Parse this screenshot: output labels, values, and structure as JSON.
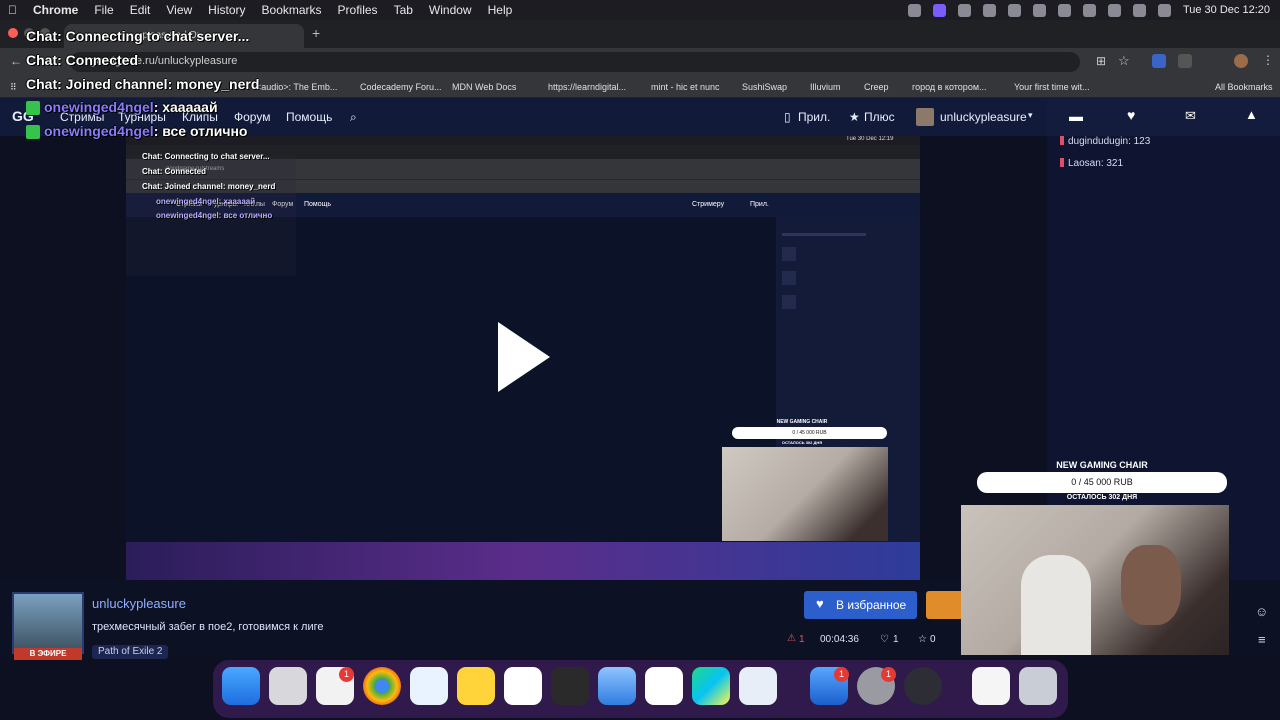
{
  "menubar": {
    "app": "Chrome",
    "items": [
      "File",
      "Edit",
      "View",
      "History",
      "Bookmarks",
      "Profiles",
      "Tab",
      "Window",
      "Help"
    ],
    "clock": "Tue 30 Dec  12:20"
  },
  "chrome": {
    "tab_title": "...pleasure / Or...",
    "url": "goodgame.ru/unluckypleasure",
    "bookmarks": [
      "<audio>: The Emb...",
      "Codecademy Foru...",
      "MDN Web Docs",
      "https://learndigital...",
      "mint - hic et nunc",
      "SushiSwap",
      "Illuvium",
      "Creep",
      "город в котором...",
      "Your first time wit...",
      "All Bookmarks"
    ]
  },
  "overlay_chat": {
    "line1": "Chat: Connecting to chat server...",
    "line2": "Chat: Connected",
    "line3": "Chat: Joined channel: money_nerd",
    "msg1_nick": "onewinged4ngel",
    "msg1_text": ": хааааай",
    "msg2_nick": "onewinged4ngel",
    "msg2_text": ": все отлично"
  },
  "site_nav": {
    "logo": "GG",
    "items": [
      "Стримы",
      "Турниры",
      "Клипы",
      "Форум",
      "Помощь"
    ],
    "app_link": "Прил.",
    "plus_link": "Плюс",
    "username": "unluckypleasure"
  },
  "right_panel": {
    "donations": [
      {
        "name": "dugindudugin",
        "amount": "123"
      },
      {
        "name": "Laosan",
        "amount": "321"
      }
    ]
  },
  "inner_screen": {
    "chat_line1": "Chat: Connecting to chat server...",
    "chat_line2": "Chat: Connected",
    "chat_line3": "Chat: Joined channel: money_nerd",
    "msg1": "onewinged4ngel: хааааай",
    "msg2": "onewinged4ngel: все отлично",
    "url": "goodgame.ru/streams",
    "nav": [
      "Стримы",
      "Турниры",
      "Клипы",
      "Форум",
      "Помощь"
    ],
    "streamer_btn": "Стримеру",
    "app_btn": "Прил.",
    "clock": "Tue 30 Dec 12:19",
    "goal_title": "NEW GAMING CHAIR",
    "goal_amount": "0 / 45 000 RUB",
    "goal_left": "ОСТАЛОСЬ 302 ДНЯ"
  },
  "goal": {
    "title": "NEW GAMING CHAIR",
    "amount": "0 / 45 000 RUB",
    "left": "ОСТАЛОСЬ 302 ДНЯ"
  },
  "stream_info": {
    "streamer": "unluckypleasure",
    "title": "трехмесячный забег в пое2, готовимся к лиге",
    "game": "Path of Exile 2",
    "live": "В ЭФИРЕ",
    "fav_button": "В избранное",
    "viewers": "1",
    "uptime": "00:04:36",
    "likes": "1",
    "stars": "0"
  },
  "dock": {
    "badges": [
      "1",
      "1",
      "1"
    ]
  }
}
